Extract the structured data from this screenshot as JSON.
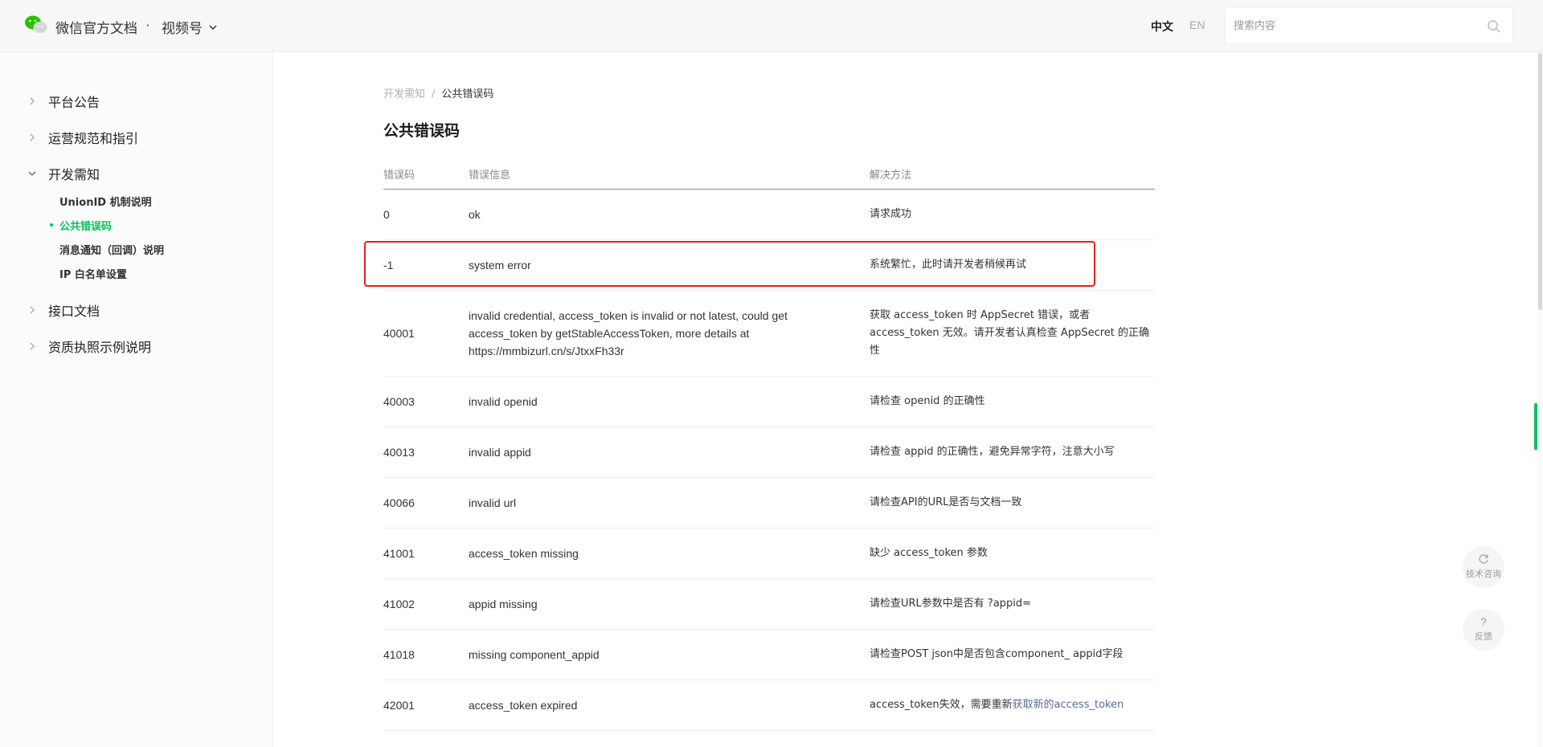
{
  "header": {
    "brand_title": "微信官方文档",
    "brand_dot": "·",
    "product": "视频号",
    "lang_zh": "中文",
    "lang_en": "EN",
    "search_placeholder": "搜索内容"
  },
  "sidebar": {
    "items": [
      {
        "label": "平台公告",
        "expanded": false
      },
      {
        "label": "运营规范和指引",
        "expanded": false
      },
      {
        "label": "开发需知",
        "expanded": true
      },
      {
        "label": "接口文档",
        "expanded": false
      },
      {
        "label": "资质执照示例说明",
        "expanded": false
      }
    ],
    "subitems": [
      {
        "label": "UnionID 机制说明",
        "active": false
      },
      {
        "label": "公共错误码",
        "active": true
      },
      {
        "label": "消息通知（回调）说明",
        "active": false
      },
      {
        "label": "IP 白名单设置",
        "active": false
      }
    ]
  },
  "breadcrumb": {
    "parent": "开发需知",
    "separator": "/",
    "current": "公共错误码"
  },
  "page_title": "公共错误码",
  "table": {
    "headers": [
      "错误码",
      "错误信息",
      "解决方法"
    ],
    "rows": [
      {
        "code": "0",
        "msg": "ok",
        "sol": "请求成功"
      },
      {
        "code": "-1",
        "msg": "system error",
        "sol": "系统繁忙，此时请开发者稍候再试"
      },
      {
        "code": "40001",
        "msg": "invalid credential, access_token is invalid or not latest, could get access_token by getStableAccessToken, more details at https://mmbizurl.cn/s/JtxxFh33r",
        "sol": "获取 access_token 时 AppSecret 错误，或者 access_token 无效。请开发者认真检查 AppSecret 的正确性"
      },
      {
        "code": "40003",
        "msg": "invalid openid",
        "sol": "请检查 openid 的正确性"
      },
      {
        "code": "40013",
        "msg": "invalid appid",
        "sol": "请检查 appid 的正确性，避免异常字符，注意大小写"
      },
      {
        "code": "40066",
        "msg": "invalid url",
        "sol": "请检查API的URL是否与文档一致"
      },
      {
        "code": "41001",
        "msg": "access_token missing",
        "sol": "缺少 access_token 参数"
      },
      {
        "code": "41002",
        "msg": "appid missing",
        "sol": "请检查URL参数中是否有 ?appid="
      },
      {
        "code": "41018",
        "msg": "missing component_appid",
        "sol": "请检查POST json中是否包含component_ appid字段"
      },
      {
        "code": "42001",
        "msg": "access_token expired",
        "sol_prefix": "access_token失效，需要重新",
        "sol_link": "获取新的access_token"
      }
    ]
  },
  "float": {
    "consult": "技术咨询",
    "feedback_icon": "?",
    "feedback": "反馈"
  },
  "colors": {
    "accent": "#07c160",
    "highlight_border": "#e02020",
    "link": "#576b95"
  }
}
